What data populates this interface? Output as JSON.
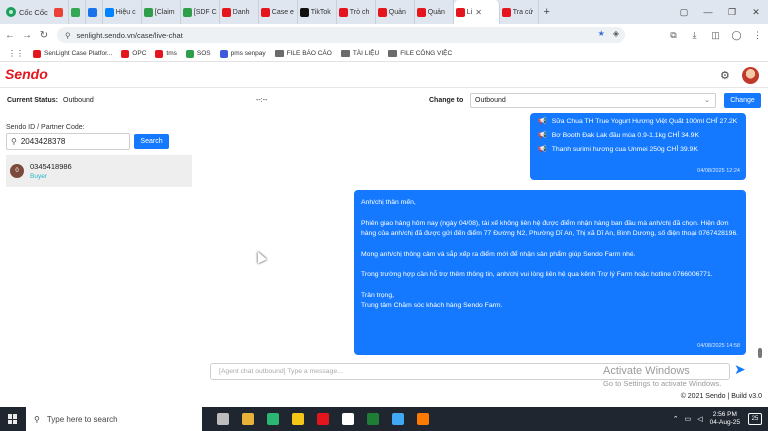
{
  "browser": {
    "brand": "Cốc Cốc",
    "tabs": [
      {
        "label": "",
        "color": "#ea4335",
        "kind": "gmail"
      },
      {
        "label": "",
        "color": "#34a853",
        "kind": "gmail"
      },
      {
        "label": "",
        "color": "#1a73e8",
        "kind": "gmail"
      },
      {
        "label": "Hiệu c",
        "color": "#0084ff"
      },
      {
        "label": "[Claim",
        "color": "#2e9e49"
      },
      {
        "label": "[SDF C",
        "color": "#2e9e49"
      },
      {
        "label": "Danh",
        "color": "#e5151d"
      },
      {
        "label": "Case e",
        "color": "#e5151d"
      },
      {
        "label": "TikTok",
        "color": "#111111"
      },
      {
        "label": "Trò ch",
        "color": "#e5151d"
      },
      {
        "label": "Quản",
        "color": "#e5151d"
      },
      {
        "label": "Quản",
        "color": "#e5151d"
      },
      {
        "label": "Li",
        "color": "#e5151d",
        "active": true
      },
      {
        "label": "Tra cứ",
        "color": "#e5151d"
      }
    ],
    "new_tab": "+",
    "url": "senlight.sendo.vn/case/live-chat",
    "bookmarks": [
      {
        "label": "SenLight Case Platfor...",
        "color": "#e5151d",
        "folder": false
      },
      {
        "label": "OPC",
        "color": "#e5151d",
        "folder": false
      },
      {
        "label": "tms",
        "color": "#e5151d",
        "folder": false
      },
      {
        "label": "SOS",
        "color": "#2e9e49",
        "folder": false
      },
      {
        "label": "pms senpay",
        "color": "#3b5bdb",
        "folder": false
      },
      {
        "label": "FILE BÁO CÁO",
        "color": "#6b6b6b",
        "folder": true
      },
      {
        "label": "TÀI LIỆU",
        "color": "#6b6b6b",
        "folder": true
      },
      {
        "label": "FILE CÔNG VIỆC",
        "color": "#6b6b6b",
        "folder": true
      }
    ]
  },
  "app": {
    "logo": "Sendo",
    "status": {
      "label": "Current Status:",
      "value": "Outbound",
      "timer": "--:--",
      "change_to_label": "Change to",
      "change_to_value": "Outbound",
      "change_button": "Change"
    },
    "left": {
      "id_label": "Sendo ID / Partner Code:",
      "search_value": "2043428378",
      "search_button": "Search",
      "contact_initial": "0",
      "contact_phone": "0345418986",
      "contact_role": "Buyer"
    },
    "chat": {
      "product_items": [
        "Sữa Chua TH True Yogurt Hương Việt Quất 100ml CHỈ 27.2K",
        "Bơ Booth Đak Lak đầu mùa 0.9-1.1kg CHỈ 34.9K",
        "Thanh surimi hương cua Unmei 250g CHỈ 39.9K"
      ],
      "product_time": "04/08/2025 12:24",
      "message_paragraphs": [
        "Anh/chị thân mến,",
        "Phiên giao hàng hôm nay (ngày 04/08), tài xế không liên hệ được điểm nhận hàng ban đầu mà anh/chị đã chọn. Hiện đơn hàng của anh/chị đã được gửi đến điểm 77 Đường N2, Phường Dĩ An, Thị xã Dĩ An, Bình Dương, số điện thoại 0767428196.",
        "Mong anh/chị thông cảm và sắp xếp ra điểm mới để nhận sản phẩm giúp Sendo Farm nhé.",
        "Trong trường hợp cần hỗ trợ thêm thông tin, anh/chị vui lòng liên hệ qua kênh Trợ lý Farm hoặc hotline 0766006771."
      ],
      "signoff_1": "Trân trọng,",
      "signoff_2": "Trung tâm Chăm sóc khách hàng Sendo Farm.",
      "message_time": "04/08/2025 14:58",
      "input_placeholder": "[Agent chat outbound] Type a message..."
    },
    "footer": "© 2021 Sendo | Build v3.0",
    "watermark_1": "Activate Windows",
    "watermark_2": "Go to Settings to activate Windows."
  },
  "taskbar": {
    "search_placeholder": "Type here to search",
    "time": "2:56 PM",
    "date": "04-Aug-25",
    "notifications": "25",
    "app_colors": [
      "#bdbdbd",
      "#e8b23a",
      "#2bb673",
      "#f5c518",
      "#e5151d",
      "#ffffff",
      "#1e7e34",
      "#3fa9f5",
      "#ff7a00"
    ]
  },
  "colors": {
    "primary": "#1479ff",
    "brand_red": "#e5151d"
  }
}
